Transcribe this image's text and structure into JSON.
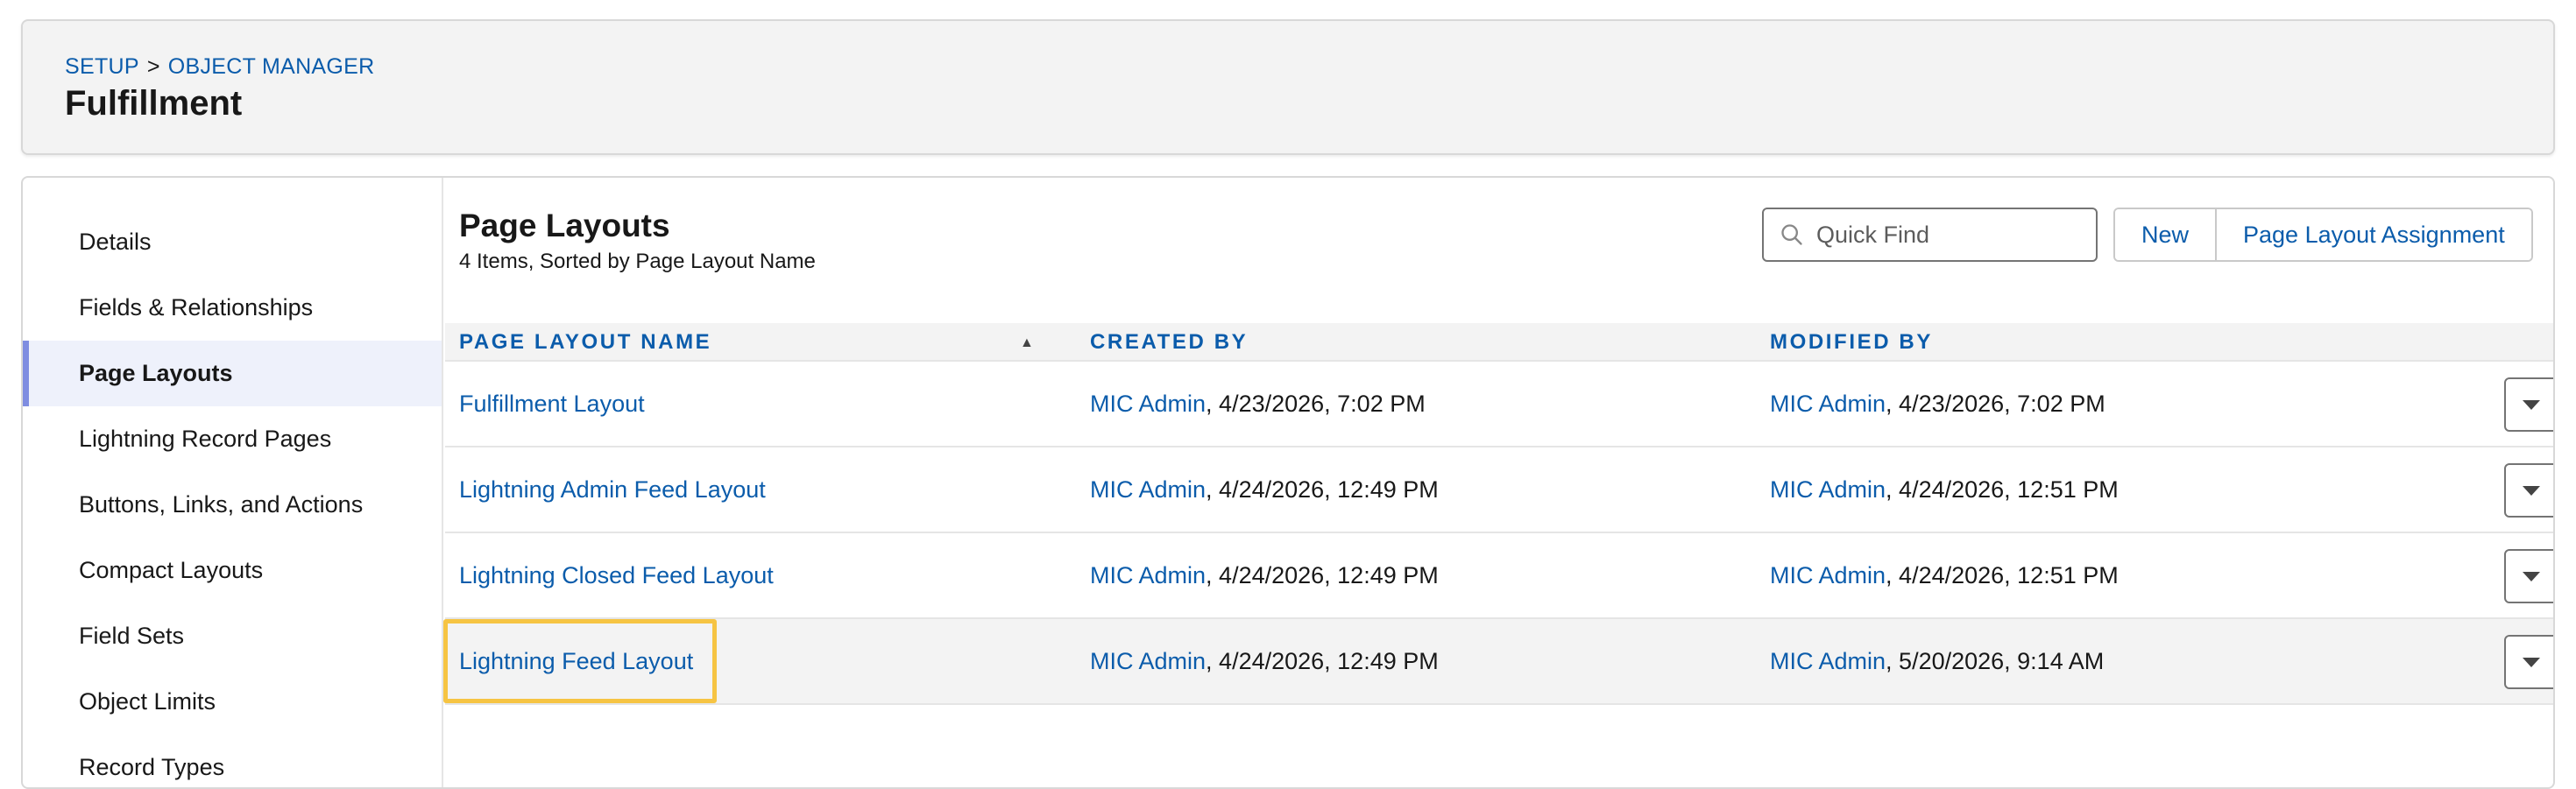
{
  "header": {
    "breadcrumb": [
      "SETUP",
      "OBJECT MANAGER"
    ],
    "breadcrumb_separator": ">",
    "title": "Fulfillment"
  },
  "sidebar": {
    "items": [
      {
        "label": "Details",
        "active": false
      },
      {
        "label": "Fields & Relationships",
        "active": false
      },
      {
        "label": "Page Layouts",
        "active": true
      },
      {
        "label": "Lightning Record Pages",
        "active": false
      },
      {
        "label": "Buttons, Links, and Actions",
        "active": false
      },
      {
        "label": "Compact Layouts",
        "active": false
      },
      {
        "label": "Field Sets",
        "active": false
      },
      {
        "label": "Object Limits",
        "active": false
      },
      {
        "label": "Record Types",
        "active": false
      }
    ]
  },
  "main": {
    "title": "Page Layouts",
    "subtitle": "4 Items, Sorted by Page Layout Name",
    "search": {
      "placeholder": "Quick Find",
      "value": ""
    },
    "buttons": {
      "new": "New",
      "assignment": "Page Layout Assignment"
    },
    "table": {
      "headers": [
        "PAGE LAYOUT NAME",
        "CREATED BY",
        "MODIFIED BY"
      ],
      "sort_direction": "ascending",
      "rows": [
        {
          "name": "Fulfillment Layout",
          "created_by_user": "MIC Admin",
          "created_at": ", 4/23/2026, 7:02 PM",
          "modified_by_user": "MIC Admin",
          "modified_at": ", 4/23/2026, 7:02 PM"
        },
        {
          "name": "Lightning Admin Feed Layout",
          "created_by_user": "MIC Admin",
          "created_at": ", 4/24/2026, 12:49 PM",
          "modified_by_user": "MIC Admin",
          "modified_at": ", 4/24/2026, 12:51 PM"
        },
        {
          "name": "Lightning Closed Feed Layout",
          "created_by_user": "MIC Admin",
          "created_at": ", 4/24/2026, 12:49 PM",
          "modified_by_user": "MIC Admin",
          "modified_at": ", 4/24/2026, 12:51 PM"
        },
        {
          "name": "Lightning Feed Layout",
          "created_by_user": "MIC Admin",
          "created_at": ", 4/24/2026, 12:49 PM",
          "modified_by_user": "MIC Admin",
          "modified_at": ", 5/20/2026, 9:14 AM"
        }
      ]
    }
  },
  "colors": {
    "link": "#0b5cab",
    "active_indicator": "#7f8de1",
    "highlight": "#f6c443"
  }
}
